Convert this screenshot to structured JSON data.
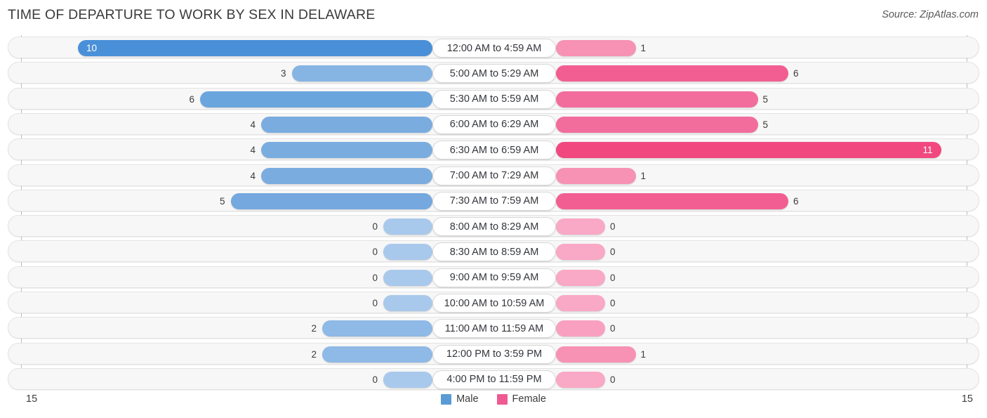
{
  "header": {
    "title": "TIME OF DEPARTURE TO WORK BY SEX IN DELAWARE",
    "source": "Source: ZipAtlas.com"
  },
  "axis": {
    "left_tick": "15",
    "right_tick": "15"
  },
  "legend": [
    {
      "label": "Male",
      "color": "#5b9bd5",
      "icon": "male-legend-swatch"
    },
    {
      "label": "Female",
      "color": "#ef5a92",
      "icon": "female-legend-swatch"
    }
  ],
  "chart_data": {
    "type": "bar",
    "orientation": "horizontal",
    "style": "diverging-bidirectional",
    "title": "TIME OF DEPARTURE TO WORK BY SEX IN DELAWARE",
    "source": "Source: ZipAtlas.com",
    "xlabel": "",
    "ylabel": "",
    "xlim": [
      15,
      15
    ],
    "axis_ticks": [
      "15",
      "15"
    ],
    "grid": false,
    "legend_position": "bottom-center",
    "categories": [
      "12:00 AM to 4:59 AM",
      "5:00 AM to 5:29 AM",
      "5:30 AM to 5:59 AM",
      "6:00 AM to 6:29 AM",
      "6:30 AM to 6:59 AM",
      "7:00 AM to 7:29 AM",
      "7:30 AM to 7:59 AM",
      "8:00 AM to 8:29 AM",
      "8:30 AM to 8:59 AM",
      "9:00 AM to 9:59 AM",
      "10:00 AM to 10:59 AM",
      "11:00 AM to 11:59 AM",
      "12:00 PM to 3:59 PM",
      "4:00 PM to 11:59 PM"
    ],
    "series": [
      {
        "name": "Male",
        "color": "#5b9bd5",
        "side": "left",
        "values": [
          10,
          3,
          6,
          4,
          4,
          4,
          5,
          0,
          0,
          0,
          0,
          2,
          2,
          0
        ]
      },
      {
        "name": "Female",
        "color": "#ef5a92",
        "side": "right",
        "values": [
          1,
          6,
          5,
          5,
          11,
          1,
          6,
          0,
          0,
          0,
          0,
          0,
          1,
          0
        ]
      }
    ]
  },
  "rows": [
    {
      "label": "12:00 AM to 4:59 AM",
      "male": "10",
      "female": "1",
      "male_inside": true,
      "female_inside": false,
      "male_color": "#4a90d9",
      "female_color": "#f792b5"
    },
    {
      "label": "5:00 AM to 5:29 AM",
      "male": "3",
      "female": "6",
      "male_inside": false,
      "female_inside": false,
      "male_color": "#87b5e3",
      "female_color": "#f25e92"
    },
    {
      "label": "5:30 AM to 5:59 AM",
      "male": "6",
      "female": "5",
      "male_inside": false,
      "female_inside": false,
      "male_color": "#6ba5dd",
      "female_color": "#f36d9c"
    },
    {
      "label": "6:00 AM to 6:29 AM",
      "male": "4",
      "female": "5",
      "male_inside": false,
      "female_inside": false,
      "male_color": "#7bacdf",
      "female_color": "#f36d9c"
    },
    {
      "label": "6:30 AM to 6:59 AM",
      "male": "4",
      "female": "11",
      "male_inside": false,
      "female_inside": true,
      "male_color": "#7bacdf",
      "female_color": "#f0487f"
    },
    {
      "label": "7:00 AM to 7:29 AM",
      "male": "4",
      "female": "1",
      "male_inside": false,
      "female_inside": false,
      "male_color": "#7bacdf",
      "female_color": "#f792b5"
    },
    {
      "label": "7:30 AM to 7:59 AM",
      "male": "5",
      "female": "6",
      "male_inside": false,
      "female_inside": false,
      "male_color": "#74a8de",
      "female_color": "#f25e92"
    },
    {
      "label": "8:00 AM to 8:29 AM",
      "male": "0",
      "female": "0",
      "male_inside": false,
      "female_inside": false,
      "male_color": "#a9c9ec",
      "female_color": "#f9a8c5"
    },
    {
      "label": "8:30 AM to 8:59 AM",
      "male": "0",
      "female": "0",
      "male_inside": false,
      "female_inside": false,
      "male_color": "#a9c9ec",
      "female_color": "#f9a8c5"
    },
    {
      "label": "9:00 AM to 9:59 AM",
      "male": "0",
      "female": "0",
      "male_inside": false,
      "female_inside": false,
      "male_color": "#a9c9ec",
      "female_color": "#f9a8c5"
    },
    {
      "label": "10:00 AM to 10:59 AM",
      "male": "0",
      "female": "0",
      "male_inside": false,
      "female_inside": false,
      "male_color": "#a9c9ec",
      "female_color": "#f9a8c5"
    },
    {
      "label": "11:00 AM to 11:59 AM",
      "male": "2",
      "female": "0",
      "male_inside": false,
      "female_inside": false,
      "male_color": "#8fb9e6",
      "female_color": "#f9a0c0"
    },
    {
      "label": "12:00 PM to 3:59 PM",
      "male": "2",
      "female": "1",
      "male_inside": false,
      "female_inside": false,
      "male_color": "#8fb9e6",
      "female_color": "#f792b5"
    },
    {
      "label": "4:00 PM to 11:59 PM",
      "male": "0",
      "female": "0",
      "male_inside": false,
      "female_inside": false,
      "male_color": "#a9c9ec",
      "female_color": "#f9a8c5"
    }
  ]
}
